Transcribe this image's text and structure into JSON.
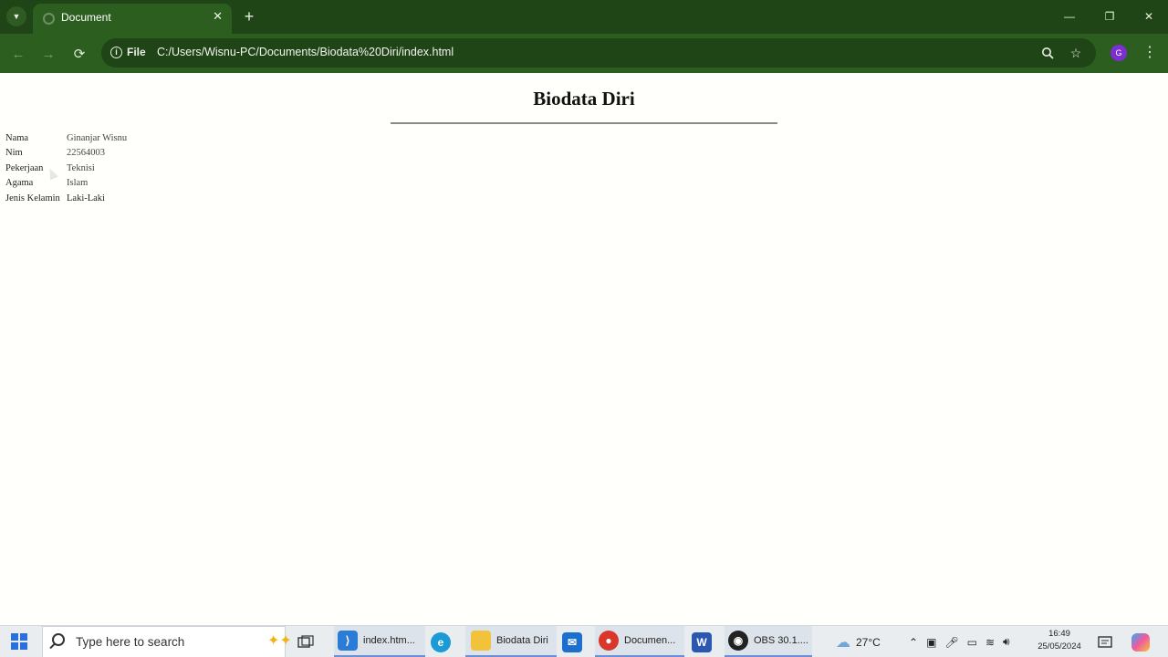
{
  "browser": {
    "tab_title": "Document",
    "tab_close": "✕",
    "new_tab": "+",
    "window": {
      "minimize": "—",
      "restore": "❐",
      "close": "✕"
    },
    "nav": {
      "back": "←",
      "forward": "→",
      "reload": "⟳"
    },
    "chip_label": "File",
    "url": "C:/Users/Wisnu-PC/Documents/Biodata%20Diri/index.html",
    "profile_initial": "G",
    "icons": [
      "tab-search-icon",
      "zoom-icon",
      "bookmark-star-icon",
      "menu-kebab-icon"
    ]
  },
  "page": {
    "title": "Biodata Diri",
    "rows": [
      {
        "label": "Nama",
        "value": "Ginanjar Wisnu"
      },
      {
        "label": "Nim",
        "value": "22564003"
      },
      {
        "label": "Pekerjaan",
        "value": "Teknisi"
      },
      {
        "label": "Agama",
        "value": "Islam"
      },
      {
        "label": "Jenis Kelamin",
        "value": "Laki-Laki"
      }
    ]
  },
  "taskbar": {
    "search_placeholder": "Type here to search",
    "apps": [
      {
        "name": "vscode",
        "label": "index.htm..."
      },
      {
        "name": "edge",
        "label": ""
      },
      {
        "name": "explorer",
        "label": "Biodata Diri"
      },
      {
        "name": "mail",
        "label": ""
      },
      {
        "name": "chrome",
        "label": "Documen..."
      },
      {
        "name": "word",
        "label": ""
      },
      {
        "name": "obs",
        "label": "OBS 30.1...."
      }
    ],
    "weather": "27°C",
    "time": "16:49",
    "date": "25/05/2024",
    "colors": {
      "accent": "#2c5f1f",
      "titlebar": "#1f4416",
      "taskbar": "#e9edf0"
    }
  }
}
